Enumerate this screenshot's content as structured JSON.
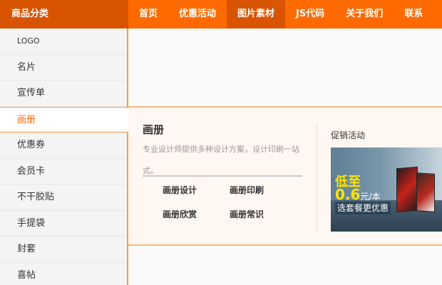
{
  "topbar": {
    "category_title": "商品分类",
    "nav": [
      "首页",
      "优惠活动",
      "图片素材",
      "JS代码",
      "关于我们",
      "联系"
    ],
    "active_index": 2
  },
  "sidebar": {
    "items": [
      "LOGO",
      "名片",
      "宣传单",
      "画册",
      "优惠券",
      "会员卡",
      "不干胶贴",
      "手提袋",
      "封套",
      "喜帖"
    ],
    "active_index": 3
  },
  "flyout": {
    "title": "画册",
    "description": "专业设计师提供多种设计方案，设计印刷一站式。",
    "links": [
      "画册设计",
      "画册印刷",
      "画册欣赏",
      "画册常识"
    ],
    "promo_label": "促销活动",
    "banner": {
      "line1": "低至",
      "price": "0.6",
      "unit": "元/本",
      "line3": "选套餐更优惠"
    }
  },
  "colors": {
    "brand": "#ff6a00",
    "brand_dark": "#d95400",
    "accent_border": "#f59b45"
  }
}
